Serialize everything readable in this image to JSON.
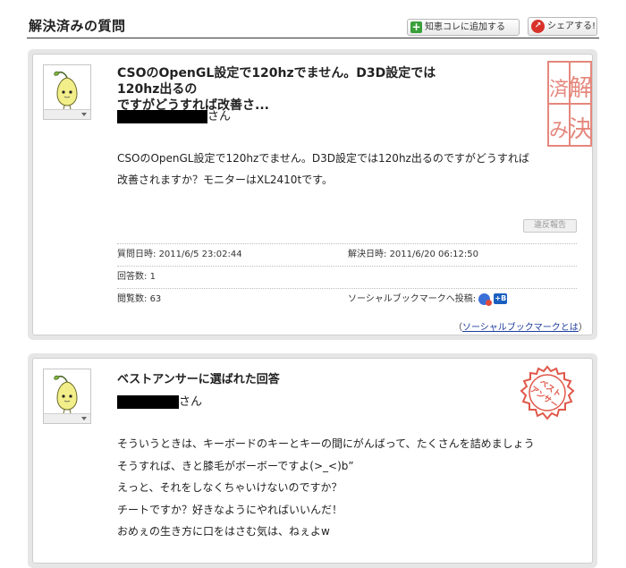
{
  "header": {
    "title": "解決済みの質問",
    "chiekore_label": "知恵コレに追加する",
    "share_label": "シェアする!"
  },
  "question": {
    "title_line1": "CSOのOpenGL設定で120hzでません。D3D設定では120hz出るの",
    "title_line2": "ですがどうすれば改善さ...",
    "name_suffix": "さん",
    "body_line1": "CSOのOpenGL設定で120hzでません。D3D設定では120hz出るのですがどうすれば",
    "body_line2": "改善されますか？モニターはXL2410tです。",
    "report_label": "違反報告",
    "stamp_chars": [
      "解",
      "決",
      "済",
      "み"
    ],
    "meta": {
      "asked_label": "質問日時:",
      "asked_value": "2011/6/5 23:02:44",
      "resolved_label": "解決日時:",
      "resolved_value": "2011/6/20 06:12:50",
      "answers_label": "回答数:",
      "answers_value": "1",
      "views_label": "閲覧数:",
      "views_value": "63",
      "social_label": "ソーシャルブックマークへ投稿:",
      "hatena_badge": "+B"
    },
    "sbm_paren_open": "（",
    "sbm_link": "ソーシャルブックマークとは",
    "sbm_paren_close": "）"
  },
  "best_answer": {
    "title": "ベストアンサーに選ばれた回答",
    "name_suffix": "さん",
    "stamp_text": [
      "ベスト",
      "アンサー"
    ],
    "lines": [
      "そういうときは、キーボードのキーとキーの間にがんばって、たくさんを詰めましょう",
      "そうすれば、きと膝毛がボーボーですよ(>_<)b”",
      "えっと、それをしなくちゃいけないのですか？",
      "チートですか？好きなようにやればいいんだ！",
      "おめぇの生き方に口をはさむ気は、ねぇよw"
    ]
  },
  "colors": {
    "stamp_red": "#e0584a",
    "link_blue": "#1d3c9c",
    "avatar_leaf": "#f2ee8a"
  },
  "icons": {
    "add": "plus-icon",
    "share": "share-icon",
    "avatar": "sprout-character-icon"
  }
}
